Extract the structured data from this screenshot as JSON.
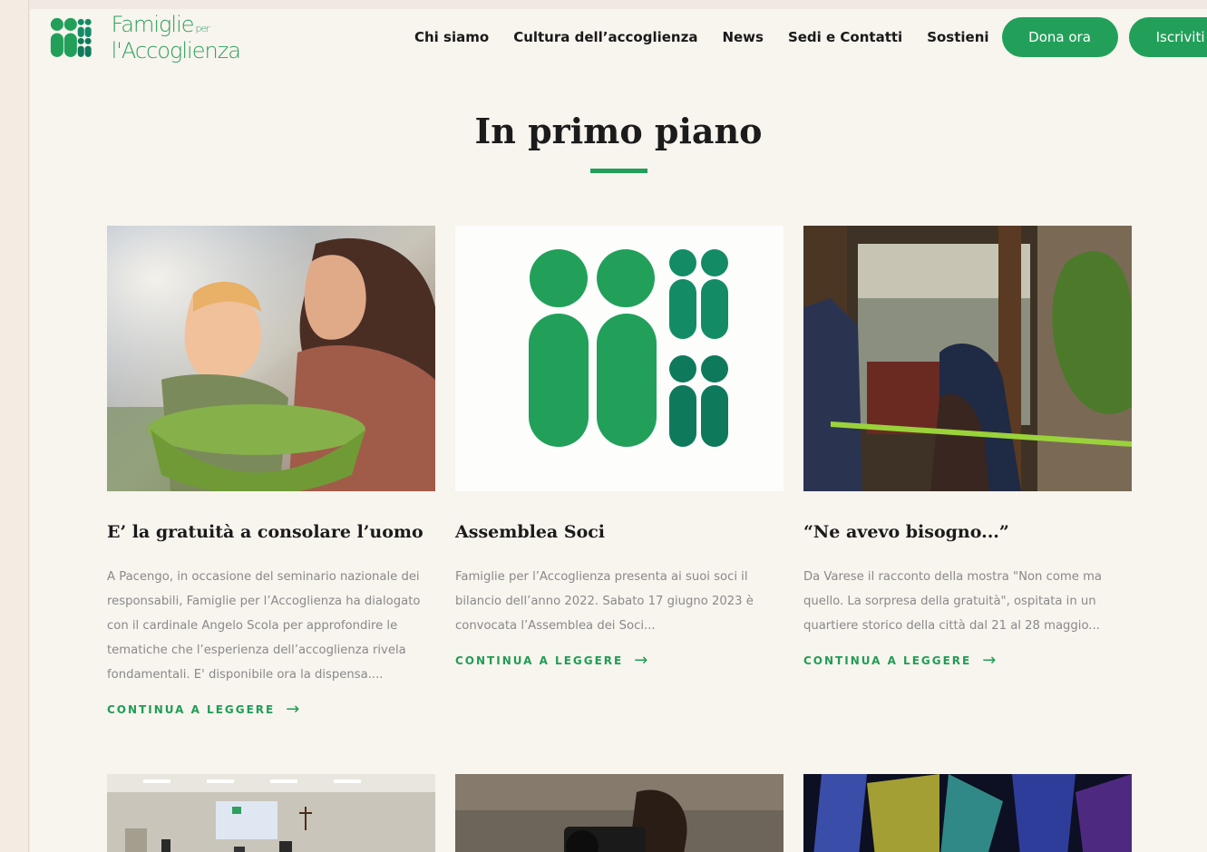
{
  "brand": {
    "name_line1": "Famiglie",
    "name_small": "per",
    "name_line2": "l'Accoglienza",
    "color": "#22a05a"
  },
  "nav": {
    "items": [
      "Chi siamo",
      "Cultura dell’accoglienza",
      "News",
      "Sedi e Contatti",
      "Sostieni"
    ],
    "donate_label": "Dona ora",
    "signup_label": "Iscriviti"
  },
  "section": {
    "title": "In primo piano"
  },
  "cards": [
    {
      "title": "E’ la gratuità a consolare l’uomo",
      "excerpt": "A Pacengo, in occasione del seminario nazionale dei responsabili, Famiglie per l’Accoglienza ha dialogato con il cardinale Angelo Scola per approfondire le tematiche che l’esperienza dell’accoglienza rivela fondamentali. E' disponibile ora la dispensa....",
      "more": "CONTINUA A LEGGERE",
      "image": "photo-mother-child-basin"
    },
    {
      "title": "Assemblea Soci",
      "excerpt": "Famiglie per l’Accoglienza presenta ai suoi soci il bilancio dell’anno 2022. Sabato 17  giugno 2023 è convocata l’Assemblea dei Soci...",
      "more": "CONTINUA A LEGGERE",
      "image": "logo-graphic"
    },
    {
      "title": "“Ne avevo bisogno...”",
      "excerpt": "Da Varese il racconto della mostra \"Non come ma quello. La sorpresa della gratuità\", ospitata in un quartiere storico della città dal 21 al 28 maggio...",
      "more": "CONTINUA A LEGGERE",
      "image": "photo-ribbon-cutting"
    }
  ],
  "more_cards": [
    {
      "image": "photo-conference-room"
    },
    {
      "image": "photo-child-camera"
    },
    {
      "image": "photo-colored-glass"
    }
  ],
  "icons": {
    "arrow": "→"
  }
}
